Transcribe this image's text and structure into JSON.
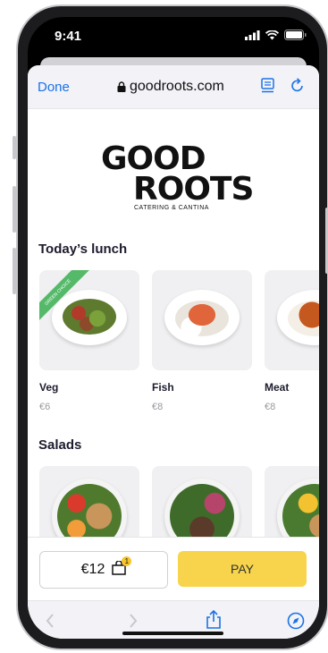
{
  "status": {
    "time": "9:41"
  },
  "browser": {
    "done_label": "Done",
    "url": "goodroots.com"
  },
  "logo": {
    "line1": "GOOD",
    "line2": "ROOTS",
    "tagline": "CATERING & CANTINA"
  },
  "sections": [
    {
      "title": "Today’s lunch",
      "items": [
        {
          "name": "Veg",
          "price": "€6",
          "ribbon": "GREEN CHOICE"
        },
        {
          "name": "Fish",
          "price": "€8"
        },
        {
          "name": "Meat",
          "price": "€8"
        }
      ]
    },
    {
      "title": "Salads"
    }
  ],
  "cart": {
    "amount": "€12",
    "count": "1"
  },
  "pay": {
    "label": "PAY"
  },
  "colors": {
    "accent": "#1a73e8",
    "pay": "#f7d44c",
    "ribbon": "#55b96a"
  },
  "icons": [
    "lock-icon",
    "reader-icon",
    "reload-icon",
    "back-icon",
    "forward-icon",
    "share-icon",
    "compass-icon",
    "bag-icon"
  ]
}
